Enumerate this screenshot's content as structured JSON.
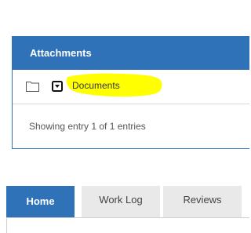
{
  "attachments": {
    "title": "Attachments",
    "file": {
      "folder_icon": "folder-icon",
      "toggle_icon": "caret-down-box-icon",
      "name": "Documents",
      "highlight_color": "#ffff00"
    },
    "footer_text": "Showing entry 1 of 1 entries"
  },
  "tabs": [
    {
      "label": "Home",
      "active": true
    },
    {
      "label": "Work Log",
      "active": false
    },
    {
      "label": "Reviews",
      "active": false
    }
  ],
  "colors": {
    "primary": "#2f72b8",
    "tab_inactive": "#e9e9e9"
  }
}
